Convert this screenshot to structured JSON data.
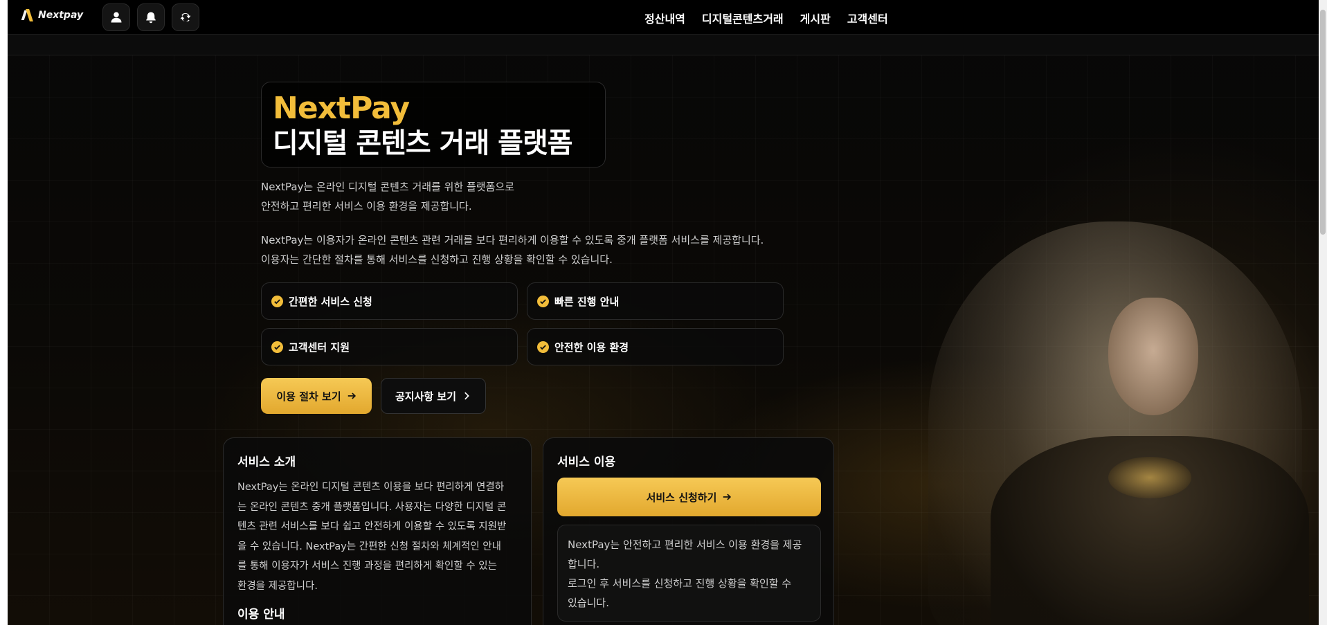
{
  "header": {
    "logo_text": "Nextpay",
    "buttons": [
      {
        "name": "profile",
        "icon": "user-icon"
      },
      {
        "name": "notifications",
        "icon": "bell-icon"
      },
      {
        "name": "refresh",
        "icon": "refresh-icon"
      }
    ],
    "nav": [
      "정산내역",
      "디지털콘텐츠거래",
      "게시판",
      "고객센터"
    ]
  },
  "hero": {
    "brand": "NextPay",
    "title": "디지털 콘텐츠 거래 플랫폼",
    "desc1_line1": "NextPay는 온라인 디지털 콘텐츠 거래를 위한 플랫폼으로",
    "desc1_line2": "안전하고 편리한 서비스 이용 환경을 제공합니다.",
    "desc2_line1": "NextPay는 이용자가 온라인 콘텐츠 관련 거래를 보다 편리하게 이용할 수 있도록 중개 플랫폼 서비스를 제공합니다.",
    "desc2_line2": "이용자는 간단한 절차를 통해 서비스를 신청하고 진행 상황을 확인할 수 있습니다."
  },
  "features": [
    "간편한 서비스 신청",
    "빠른 진행 안내",
    "고객센터 지원",
    "안전한 이용 환경"
  ],
  "buttons": {
    "procedure": "이용 절차 보기",
    "notice": "공지사항 보기"
  },
  "intro_card": {
    "title": "서비스 소개",
    "lines": [
      "NextPay는 온라인 디지털 콘텐츠 이용을 보다 편리하게 연결하",
      "는 온라인 콘텐츠 중개 플랫폼입니다. 사용자는 다양한 디지털 콘",
      "텐츠 관련 서비스를 보다 쉽고 안전하게 이용할 수 있도록 지원받",
      "을 수 있습니다. NextPay는 간편한 신청 절차와 체계적인 안내",
      "를 통해 이용자가 서비스 진행 과정을 편리하게 확인할 수 있는",
      "환경을 제공합니다."
    ],
    "subtitle": "이용 안내"
  },
  "use_card": {
    "title": "서비스 이용",
    "apply_label": "서비스 신청하기",
    "notice_lines": [
      "NextPay는 안전하고 편리한 서비스 이용 환경을 제공",
      "합니다.",
      "로그인 후 서비스를 신청하고 진행 상황을 확인할 수",
      "있습니다."
    ]
  },
  "colors": {
    "accent": "#f2bd3a",
    "background": "#050505",
    "card_border": "#2a2a2a"
  }
}
